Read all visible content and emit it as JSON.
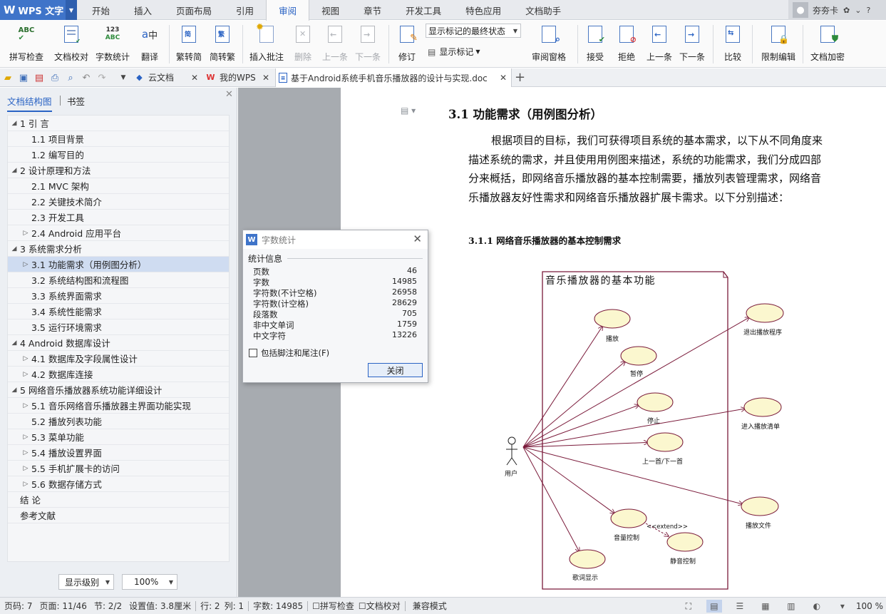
{
  "app": {
    "logo_mark": "W",
    "logo_name": "WPS 文字"
  },
  "menu_tabs": [
    "开始",
    "插入",
    "页面布局",
    "引用",
    "审阅",
    "视图",
    "章节",
    "开发工具",
    "特色应用",
    "文档助手"
  ],
  "user": {
    "name": "夯夯卡"
  },
  "ribbon": {
    "spellcheck": "拼写检查",
    "doc_proof": "文档校对",
    "word_count": "字数统计",
    "translate": "翻译",
    "trad_to_simp": "繁转简",
    "simp_to_trad": "简转繁",
    "insert_comment": "插入批注",
    "delete": "删除",
    "prev": "上一条",
    "next": "下一条",
    "track": "修订",
    "markup_display": "显示标记的最终状态",
    "show_markup": "显示标记",
    "review_pane": "审阅窗格",
    "accept": "接受",
    "reject": "拒绝",
    "prev_change": "上一条",
    "next_change": "下一条",
    "compare": "比较",
    "restrict_edit": "限制编辑",
    "encrypt": "文档加密"
  },
  "doc_tabs": {
    "cloud": "云文档",
    "mywps": "我的WPS",
    "document": "基于Android系统手机音乐播放器的设计与实现.doc",
    "add": "+"
  },
  "nav": {
    "tab_outline": "文档结构图",
    "tab_bookmark": "书签",
    "outline": [
      {
        "label": "1 引 言",
        "level": 1,
        "toggle": "◢"
      },
      {
        "label": "1.1  项目背景",
        "level": 2,
        "toggle": ""
      },
      {
        "label": "1.2  编写目的",
        "level": 2,
        "toggle": ""
      },
      {
        "label": "2 设计原理和方法",
        "level": 1,
        "toggle": "◢"
      },
      {
        "label": "2.1 MVC 架构",
        "level": 2,
        "toggle": ""
      },
      {
        "label": "2.2  关键技术简介",
        "level": 2,
        "toggle": ""
      },
      {
        "label": "2.3  开发工具",
        "level": 2,
        "toggle": ""
      },
      {
        "label": "2.4 Android 应用平台",
        "level": 2,
        "toggle": "▷"
      },
      {
        "label": "3 系统需求分析",
        "level": 1,
        "toggle": "◢"
      },
      {
        "label": "3.1  功能需求（用例图分析）",
        "level": 2,
        "toggle": "▷",
        "selected": true
      },
      {
        "label": "3.2  系统结构图和流程图",
        "level": 2,
        "toggle": ""
      },
      {
        "label": "3.3  系统界面需求",
        "level": 2,
        "toggle": ""
      },
      {
        "label": "3.4  系统性能需求",
        "level": 2,
        "toggle": ""
      },
      {
        "label": "3.5  运行环境需求",
        "level": 2,
        "toggle": ""
      },
      {
        "label": "4 Android 数据库设计",
        "level": 1,
        "toggle": "◢"
      },
      {
        "label": "4.1  数据库及字段属性设计",
        "level": 2,
        "toggle": "▷"
      },
      {
        "label": "4.2  数据库连接",
        "level": 2,
        "toggle": "▷"
      },
      {
        "label": "5 网络音乐播放器系统功能详细设计",
        "level": 1,
        "toggle": "◢"
      },
      {
        "label": "5.1 音乐网络音乐播放器主界面功能实现",
        "level": 2,
        "toggle": "▷"
      },
      {
        "label": "5.2  播放列表功能",
        "level": 2,
        "toggle": ""
      },
      {
        "label": "5.3  菜单功能",
        "level": 2,
        "toggle": "▷"
      },
      {
        "label": "5.4  播放设置界面",
        "level": 2,
        "toggle": "▷"
      },
      {
        "label": "5.5  手机扩展卡的访问",
        "level": 2,
        "toggle": "▷"
      },
      {
        "label": "5.6  数据存储方式",
        "level": 2,
        "toggle": "▷"
      },
      {
        "label": "结 论",
        "level": 1,
        "toggle": ""
      },
      {
        "label": "参考文献",
        "level": 1,
        "toggle": ""
      }
    ],
    "level_select": "显示级别",
    "zoom_select": "100%"
  },
  "document": {
    "heading": "3.1  功能需求（用例图分析）",
    "paragraph": "根据项目的目标，我们可获得项目系统的基本需求，以下从不同角度来描述系统的需求，并且使用用例图来描述，系统的功能需求，我们分成四部分来概括，即网络音乐播放器的基本控制需要，播放列表管理需求，网络音乐播放器友好性需求和网络音乐播放器扩展卡需求。以下分别描述：",
    "subheading": "3.1.1  网络音乐播放器的基本控制需求",
    "diagram": {
      "package_title": "音乐播放器的基本功能",
      "actor": "用户",
      "usecases_inside": [
        "播放",
        "暂停",
        "停止",
        "上一首/下一首",
        "音量控制",
        "静音控制",
        "歌词显示"
      ],
      "usecases_outside": [
        "退出播放程序",
        "进入播放清单",
        "播放文件"
      ],
      "extend_label": "<<extend>>"
    }
  },
  "dialog": {
    "title": "字数统计",
    "section": "统计信息",
    "stats": [
      {
        "label": "页数",
        "value": "46"
      },
      {
        "label": "字数",
        "value": "14985"
      },
      {
        "label": "字符数(不计空格)",
        "value": "26958"
      },
      {
        "label": "字符数(计空格)",
        "value": "28629"
      },
      {
        "label": "段落数",
        "value": "705"
      },
      {
        "label": "非中文单词",
        "value": "1759"
      },
      {
        "label": "中文字符",
        "value": "13226"
      }
    ],
    "checkbox": "包括脚注和尾注(F)",
    "close_button": "关闭"
  },
  "status": {
    "page_code": "页码: 7",
    "page": "页面: 11/46",
    "section": "节: 2/2",
    "setting": "设置值: 3.8厘米",
    "row": "行: 2",
    "col": "列: 1",
    "words": "字数: 14985",
    "spell": "拼写检查",
    "proof": "文档校对",
    "compat": "兼容模式",
    "zoom": "100 %"
  },
  "colors": {
    "accent": "#2a63c4",
    "logo": "#3f74c9",
    "diagram_line": "#7a1a3a",
    "usecase_fill": "#fbf7cf"
  }
}
